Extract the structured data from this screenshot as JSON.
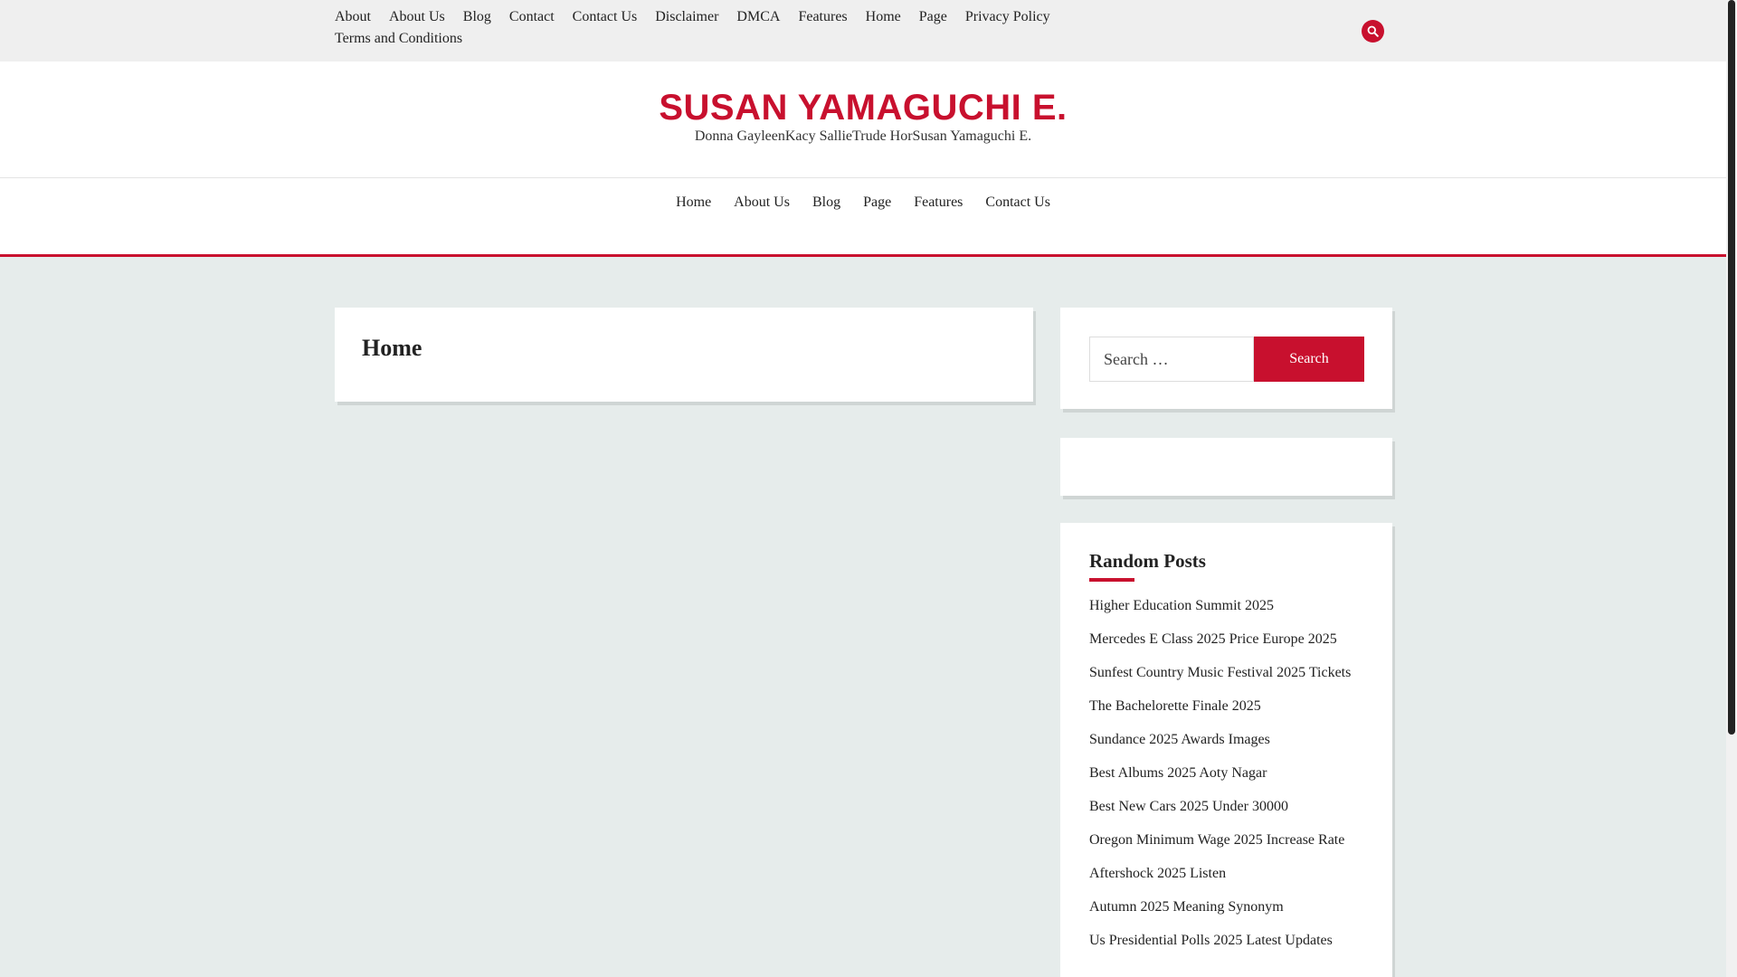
{
  "topnav": {
    "items": [
      "About",
      "About Us",
      "Blog",
      "Contact",
      "Contact Us",
      "Disclaimer",
      "DMCA",
      "Features",
      "Home",
      "Page",
      "Privacy Policy",
      "Terms and Conditions"
    ],
    "search_icon": "search-icon"
  },
  "site": {
    "title": "SUSAN YAMAGUCHI E.",
    "tagline": "Donna GayleenKacy SallieTrude HorSusan Yamaguchi E."
  },
  "mainnav": {
    "items": [
      "Home",
      "About Us",
      "Blog",
      "Page",
      "Features",
      "Contact Us"
    ]
  },
  "content": {
    "page_title": "Home"
  },
  "sidebar": {
    "search": {
      "placeholder": "Search …",
      "button_label": "Search"
    },
    "random_posts": {
      "title": "Random Posts",
      "items": [
        "Higher Education Summit 2025",
        "Mercedes E Class 2025 Price Europe 2025",
        "Sunfest Country Music Festival 2025 Tickets",
        "The Bachelorette Finale 2025",
        "Sundance 2025 Awards Images",
        "Best Albums 2025 Aoty Nagar",
        "Best New Cars 2025 Under 30000",
        "Oregon Minimum Wage 2025 Increase Rate",
        "Aftershock 2025 Listen",
        "Autumn 2025 Meaning Synonym",
        "Us Presidential Polls 2025 Latest Updates"
      ]
    }
  },
  "colors": {
    "accent": "#c8102e",
    "background": "#e6eceb"
  }
}
